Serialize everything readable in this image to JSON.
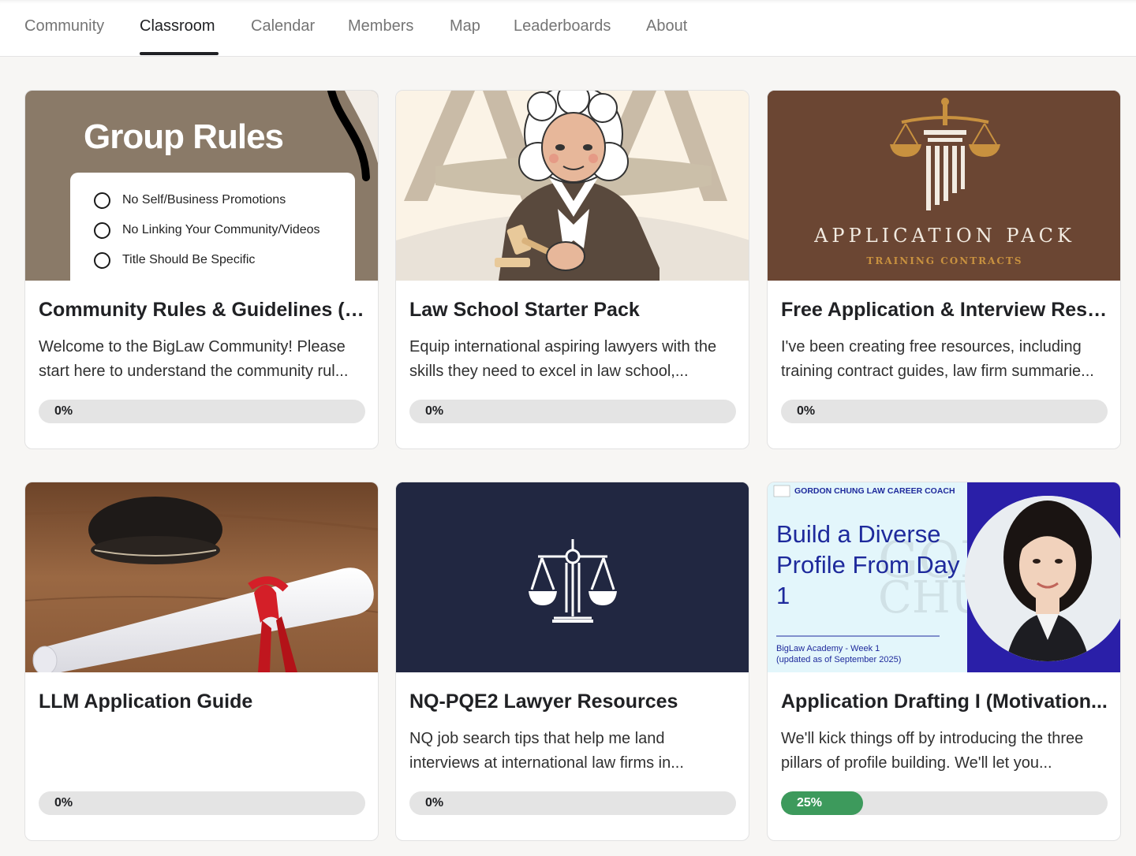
{
  "nav": {
    "tabs": [
      {
        "label": "Community",
        "active": false
      },
      {
        "label": "Classroom",
        "active": true
      },
      {
        "label": "Calendar",
        "active": false
      },
      {
        "label": "Members",
        "active": false
      },
      {
        "label": "Map",
        "active": false
      },
      {
        "label": "Leaderboards",
        "active": false
      },
      {
        "label": "About",
        "active": false
      }
    ]
  },
  "courses": [
    {
      "title": "Community Rules & Guidelines (S...",
      "description": "Welcome to the BigLaw Community! Please start here to understand the community rul...",
      "progress": 0,
      "progress_label": "0%",
      "thumbnail": {
        "heading": "Group Rules",
        "rules": [
          "No Self/Business Promotions",
          "No Linking Your Community/Videos",
          "Title Should Be Specific"
        ]
      }
    },
    {
      "title": "Law School Starter Pack",
      "description": "Equip international aspiring lawyers with the skills they need to excel in law school,...",
      "progress": 0,
      "progress_label": "0%",
      "thumbnail": {
        "icon": "judge-illustration-icon"
      }
    },
    {
      "title": "Free Application & Interview Reso...",
      "description": "I've been creating free resources, including training contract guides, law firm summarie...",
      "progress": 0,
      "progress_label": "0%",
      "thumbnail": {
        "title": "APPLICATION PACK",
        "subtitle": "TRAINING CONTRACTS",
        "icon": "scales-pillar-icon"
      }
    },
    {
      "title": "LLM Application Guide",
      "description": "",
      "progress": 0,
      "progress_label": "0%",
      "thumbnail": {
        "icon": "diploma-scroll-icon"
      }
    },
    {
      "title": "NQ-PQE2 Lawyer Resources",
      "description": "NQ job search tips that help me land interviews at international law firms in...",
      "progress": 0,
      "progress_label": "0%",
      "thumbnail": {
        "icon": "scales-of-justice-icon"
      }
    },
    {
      "title": "Application Drafting I (Motivation...",
      "description": "We'll kick things off by introducing the three pillars of profile building. We'll let you...",
      "progress": 0.25,
      "progress_label": "25%",
      "thumbnail": {
        "header": "GORDON CHUNG LAW CAREER COACH",
        "title": "Build a Diverse Profile From Day 1",
        "footer_line1": "BigLaw Academy - Week 1",
        "footer_line2": "(updated as of September 2025)",
        "icon": "coach-portrait-icon"
      }
    }
  ],
  "colors": {
    "progress_fill": "#3d9a5c",
    "progress_track": "#e4e4e4",
    "rules_bg": "#8a7a68",
    "application_bg": "#6b4633",
    "nq_bg": "#212741",
    "academy_blue": "#1e2a9c"
  }
}
